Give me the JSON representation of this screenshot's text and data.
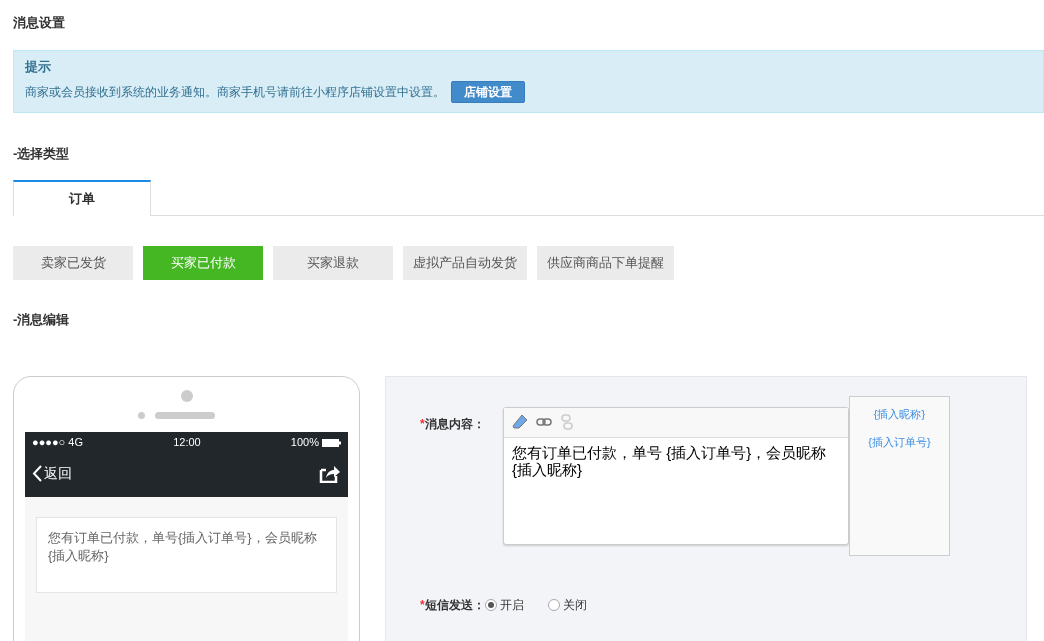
{
  "page_title": "消息设置",
  "notice": {
    "title": "提示",
    "text": "商家或会员接收到系统的业务通知。商家手机号请前往小程序店铺设置中设置。",
    "button": "店铺设置"
  },
  "type_heading": "-选择类型",
  "tabs": [
    {
      "label": "订单",
      "selected": true
    }
  ],
  "message_types": [
    {
      "label": "卖家已发货",
      "selected": false
    },
    {
      "label": "买家已付款",
      "selected": true
    },
    {
      "label": "买家退款",
      "selected": false
    },
    {
      "label": "虚拟产品自动发货",
      "selected": false
    },
    {
      "label": "供应商商品下单提醒",
      "selected": false
    }
  ],
  "edit_heading": "-消息编辑",
  "phone": {
    "signal": "●●●●○ 4G",
    "time": "12:00",
    "battery": "100%",
    "back": "返回",
    "message": "您有订单已付款，单号{插入订单号}，会员昵称{插入昵称}"
  },
  "form": {
    "content_label": "消息内容：",
    "content_required_mark": "*",
    "content": "您有订单已付款，单号 {插入订单号}，会员昵称 {插入昵称}",
    "inserts": [
      "{插入昵称}",
      "{插入订单号}"
    ],
    "sms_label": "短信发送：",
    "sms_required_mark": "*",
    "sms_options": [
      {
        "label": "开启",
        "selected": true
      },
      {
        "label": "关闭",
        "selected": false
      }
    ]
  }
}
